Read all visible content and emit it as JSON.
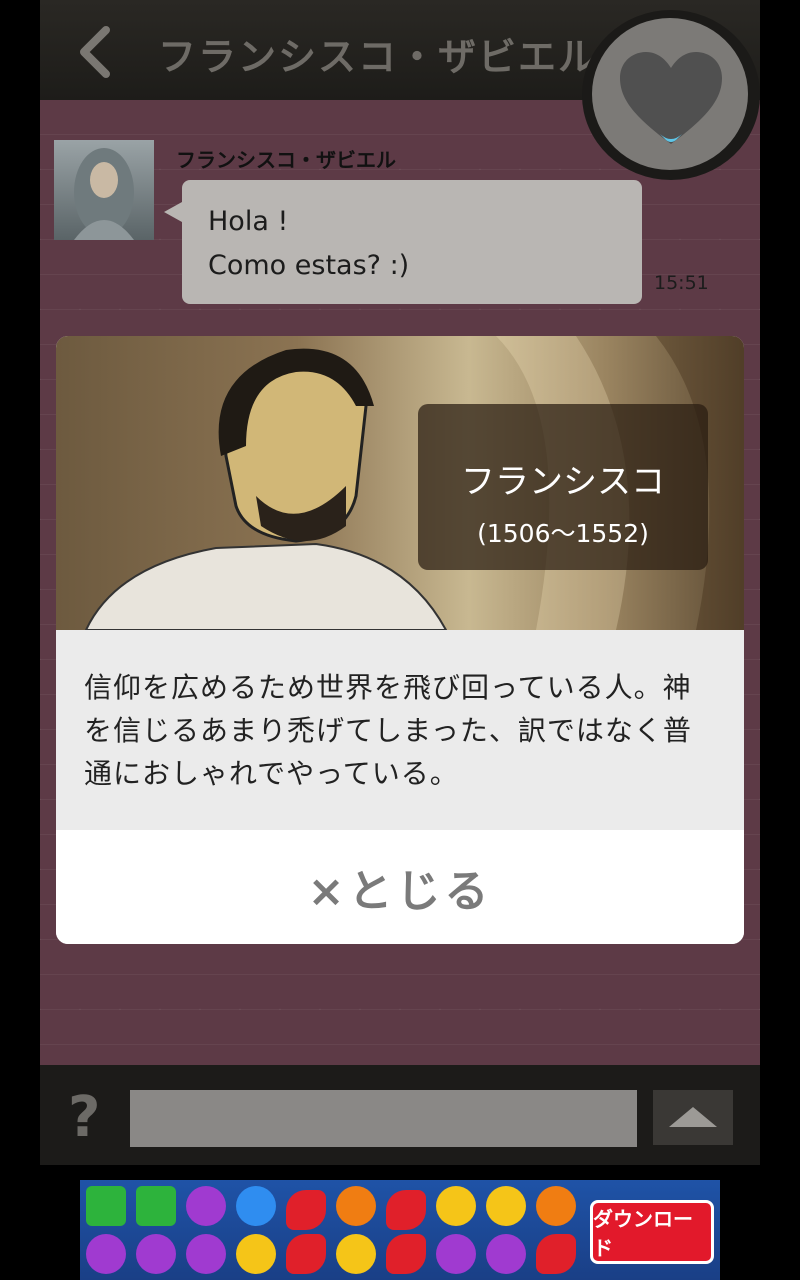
{
  "header": {
    "title": "フランシスコ・ザビエル"
  },
  "chat": {
    "message": {
      "sender": "フランシスコ・ザビエル",
      "lines": [
        "Hola !",
        "Como estas? :)"
      ],
      "time": "15:51"
    }
  },
  "favorite": {
    "icon": "heart-icon"
  },
  "modal": {
    "name": "フランシスコ",
    "years": "(1506〜1552)",
    "description": "信仰を広めるため世界を飛び回っている人。神を信じるあまり禿げてしまった、訳ではなく普通におしゃれでやっている。",
    "close_label": "×とじる"
  },
  "footer": {
    "help_symbol": "?",
    "input_value": "",
    "send_icon": "triangle-up-icon"
  },
  "ad": {
    "button_label": "ダウンロード"
  },
  "colors": {
    "chat_background": "#5d3a46",
    "header": "#1d1c19",
    "ad_button": "#e2192b"
  }
}
